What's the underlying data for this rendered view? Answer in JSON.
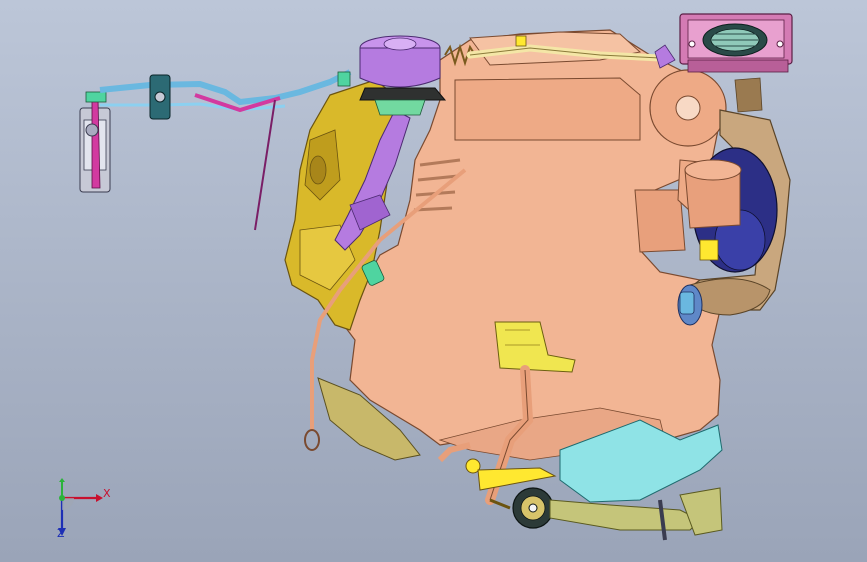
{
  "viewport": {
    "background_top": "#bcc6d8",
    "background_bottom": "#9aa4b8"
  },
  "parts": [
    {
      "name": "engine-block",
      "color": "#f2b594"
    },
    {
      "name": "intake-manifold",
      "color": "#d9b92a"
    },
    {
      "name": "egr-valve",
      "color": "#b57be0"
    },
    {
      "name": "turbocharger",
      "color": "#2c2f86"
    },
    {
      "name": "exhaust-manifold",
      "color": "#c9a77e"
    },
    {
      "name": "oil-pan",
      "color": "#8fe3e6"
    },
    {
      "name": "throttle-body",
      "color": "#c7c9d6"
    },
    {
      "name": "mount-bracket",
      "color": "#f0e650"
    },
    {
      "name": "pulley-assembly",
      "color": "#d47bb4"
    }
  ],
  "triad": {
    "x_label": "X",
    "y_label": "Z",
    "x_color": "#c8102e",
    "y_color": "#1d2fb5",
    "origin_color": "#2bb33b"
  }
}
